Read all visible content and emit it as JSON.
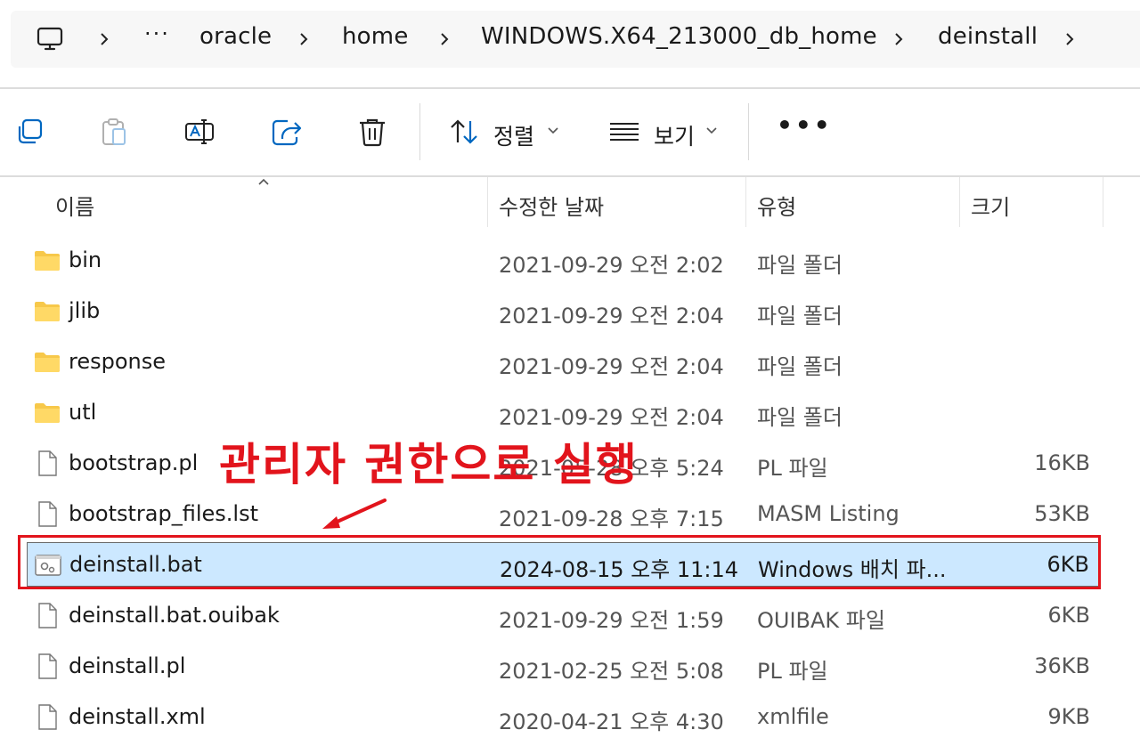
{
  "address_bar": {
    "icon": "this-pc-icon",
    "overflow": "···",
    "crumbs": [
      "oracle",
      "home",
      "WINDOWS.X64_213000_db_home",
      "deinstall"
    ]
  },
  "toolbar": {
    "icons": [
      "copy-icon",
      "paste-icon",
      "rename-icon",
      "share-icon",
      "delete-icon"
    ],
    "sort_label": "정렬",
    "view_label": "보기",
    "more": "•••"
  },
  "columns": {
    "name": "이름",
    "date": "수정한 날짜",
    "type": "유형",
    "size": "크기"
  },
  "files": [
    {
      "icon": "folder-icon",
      "name": "bin",
      "date": "2021-09-29 오전 2:02",
      "type": "파일 폴더",
      "size": ""
    },
    {
      "icon": "folder-icon",
      "name": "jlib",
      "date": "2021-09-29 오전 2:04",
      "type": "파일 폴더",
      "size": ""
    },
    {
      "icon": "folder-icon",
      "name": "response",
      "date": "2021-09-29 오전 2:04",
      "type": "파일 폴더",
      "size": ""
    },
    {
      "icon": "folder-icon",
      "name": "utl",
      "date": "2021-09-29 오전 2:04",
      "type": "파일 폴더",
      "size": ""
    },
    {
      "icon": "file-icon",
      "name": "bootstrap.pl",
      "date": "2021-05-28 오후 5:24",
      "type": "PL 파일",
      "size": "16KB"
    },
    {
      "icon": "file-icon",
      "name": "bootstrap_files.lst",
      "date": "2021-09-28 오후 7:15",
      "type": "MASM Listing",
      "size": "53KB"
    },
    {
      "icon": "batch-file-icon",
      "name": "deinstall.bat",
      "date": "2024-08-15 오후 11:14",
      "type": "Windows 배치 파...",
      "size": "6KB",
      "selected": true
    },
    {
      "icon": "file-icon",
      "name": "deinstall.bat.ouibak",
      "date": "2021-09-29 오전 1:59",
      "type": "OUIBAK 파일",
      "size": "6KB"
    },
    {
      "icon": "file-icon",
      "name": "deinstall.pl",
      "date": "2021-02-25 오전 5:08",
      "type": "PL 파일",
      "size": "36KB"
    },
    {
      "icon": "file-icon",
      "name": "deinstall.xml",
      "date": "2020-04-21 오후 4:30",
      "type": "xmlfile",
      "size": "9KB"
    }
  ],
  "annotation": {
    "text": "관리자 권한으로 실행",
    "color": "#e2141c"
  },
  "colors": {
    "selection": "#cce8ff",
    "folder": "#f7c84a",
    "accent": "#0067c0"
  }
}
